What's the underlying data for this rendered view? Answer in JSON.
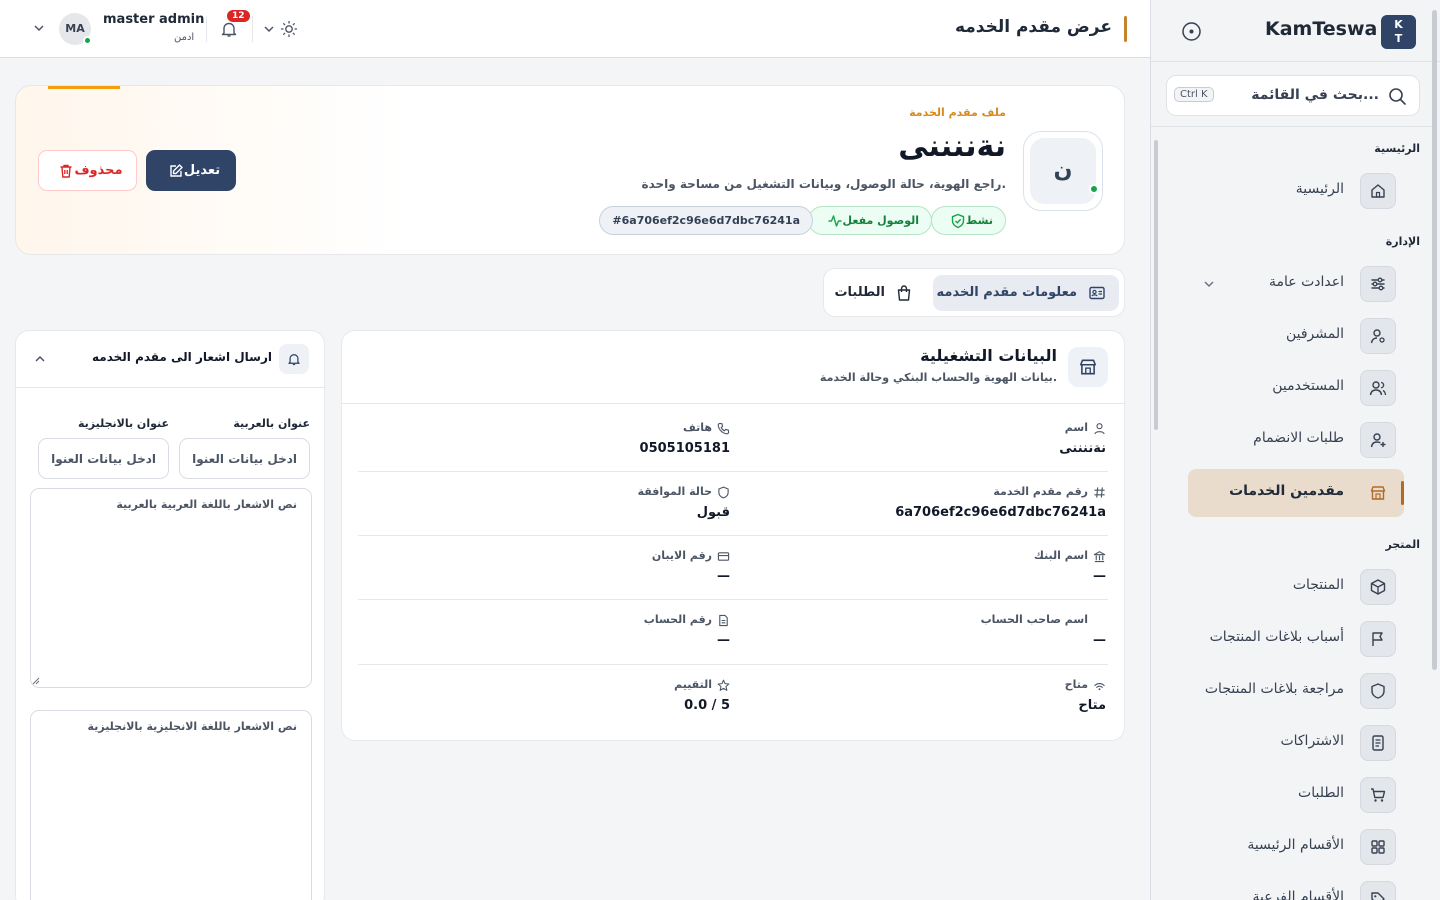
{
  "sidebar": {
    "logo_badge_line1": "K",
    "logo_badge_line2": "T",
    "brand": "KamTeswa",
    "search_placeholder": "بحث في القائمة...",
    "search_shortcut": "Ctrl K",
    "sections": {
      "main": "الرئيسية",
      "admin": "الإدارة",
      "store": "المتجر"
    },
    "items": [
      {
        "label": "الرئيسية",
        "icon": "home-icon"
      },
      {
        "label": "اعدادت عامة",
        "icon": "sliders-icon"
      },
      {
        "label": "المشرفين",
        "icon": "user-cog-icon"
      },
      {
        "label": "المستخدمين",
        "icon": "users-icon"
      },
      {
        "label": "طلبات الانضمام",
        "icon": "user-plus-icon"
      },
      {
        "label": "مقدمين الخدمات",
        "icon": "store-icon",
        "active": true
      },
      {
        "label": "المنتجات",
        "icon": "package-icon"
      },
      {
        "label": "أسباب بلاغات المنتجات",
        "icon": "flag-icon"
      },
      {
        "label": "مراجعة بلاغات المنتجات",
        "icon": "shield-icon"
      },
      {
        "label": "الاشتراكات",
        "icon": "receipt-icon"
      },
      {
        "label": "الطلبات",
        "icon": "cart-icon"
      },
      {
        "label": "الأقسام الرئيسية",
        "icon": "grid-icon"
      },
      {
        "label": "الأقسام الفرعية",
        "icon": "tag-icon"
      }
    ]
  },
  "topbar": {
    "title": "عرض مقدم الخدمه",
    "user_name": "master admin",
    "user_role": "ادمن",
    "avatar_initials": "MA",
    "notifications_count": "12"
  },
  "profile": {
    "kicker": "ملف مقدم الخدمة",
    "name": "نةننننى",
    "avatar_letter": "ن",
    "description": "راجع الهوية، حالة الوصول، وبيانات التشغيل من مساحة واحدة.",
    "badges": {
      "status": "نشط",
      "access": "الوصول مفعل",
      "id": "#6a706ef2c96e6d7dbc76241a"
    },
    "edit_label": "تعديل",
    "delete_label": "محذوف"
  },
  "tabs": {
    "info": "معلومات مقدم الخدمه",
    "orders": "الطلبات"
  },
  "operational": {
    "title": "البيانات التشغيلية",
    "subtitle": "بيانات الهوية والحساب البنكي وحالة الخدمة.",
    "fields": {
      "name_label": "اسم",
      "name_value": "نةننننى",
      "phone_label": "هاتف",
      "phone_value": "0505105181",
      "provider_no_label": "رقم مقدم الخدمة",
      "provider_no_value": "6a706ef2c96e6d7dbc76241a",
      "approval_label": "حالة الموافقة",
      "approval_value": "قبول",
      "bank_label": "اسم البنك",
      "bank_value": "—",
      "iban_label": "رقم الايبان",
      "iban_value": "—",
      "holder_label": "اسم صاحب الحساب",
      "holder_value": "—",
      "account_label": "رقم الحساب",
      "account_value": "—",
      "available_label": "متاح",
      "available_value": "متاح",
      "rating_label": "التقييم",
      "rating_value": "0.0 / 5"
    }
  },
  "notification": {
    "title": "ارسال اشعار الى مقدم الخدمه",
    "title_ar_label": "عنوان بالعربية",
    "title_en_label": "عنوان بالانجليزية",
    "title_ar_placeholder": "ادخل بيانات العنوان",
    "title_en_placeholder": "ادخل بيانات العنوان",
    "body_ar_placeholder": "نص الاشعار باللغة العربية بالعربية",
    "body_en_placeholder": "نص الاشعار باللغة الانجليزية بالانجليزية"
  },
  "colors": {
    "primary": "#2f4466",
    "accent": "#c7802c",
    "success": "#16a34a",
    "danger": "#dc2626"
  }
}
